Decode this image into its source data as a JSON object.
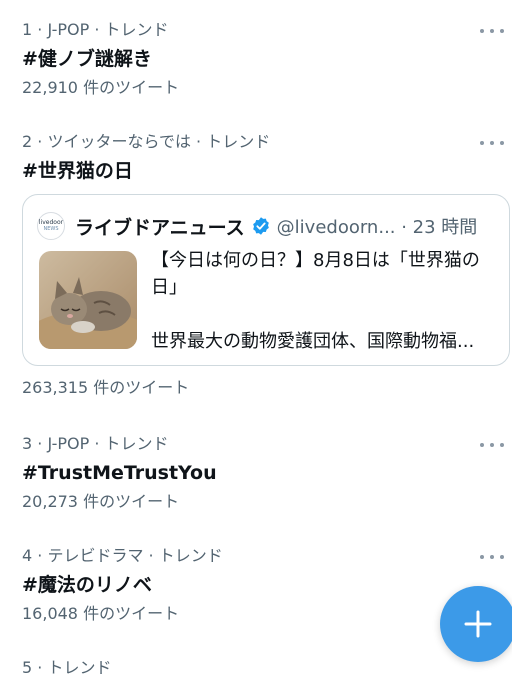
{
  "trends": [
    {
      "meta": "1 · J-POP · トレンド",
      "title": "#健ノブ謎解き",
      "count": "22,910 件のツイート"
    },
    {
      "meta": "2 · ツイッターならでは · トレンド",
      "title": "#世界猫の日",
      "count": "263,315 件のツイート"
    },
    {
      "meta": "3 · J-POP · トレンド",
      "title": "#TrustMeTrustYou",
      "count": "20,273 件のツイート"
    },
    {
      "meta": "4 · テレビドラマ · トレンド",
      "title": "#魔法のリノベ",
      "count": "16,048 件のツイート"
    },
    {
      "meta": "5 · トレンド"
    }
  ],
  "card": {
    "logo_main": "livedoor",
    "logo_sub": "NEWS",
    "source_name": "ライブドアニュース",
    "handle_time": "@livedoorn... · 23 時間",
    "headline": "【今日は何の日？】8月8日は「世界猫の日」",
    "snippet": "世界最大の動物愛護団体、国際動物福..."
  },
  "icons": {
    "more": "more-dots-icon",
    "verified": "verified-badge-icon",
    "compose": "plus-icon"
  },
  "colors": {
    "accent": "#1d9bf0",
    "fab": "#3c9ae8",
    "secondary_text": "#536471"
  }
}
